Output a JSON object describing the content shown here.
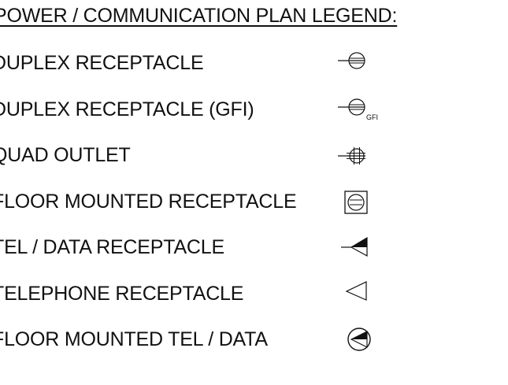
{
  "legend": {
    "title": "POWER / COMMUNICATION PLAN LEGEND:",
    "items": [
      {
        "label": "DUPLEX RECEPTACLE",
        "symbol": "duplex-receptacle-icon",
        "symbol_text": ""
      },
      {
        "label": "DUPLEX RECEPTACLE (GFI)",
        "symbol": "gfi-receptacle-icon",
        "symbol_text": "GFI"
      },
      {
        "label": "QUAD OUTLET",
        "symbol": "quad-outlet-icon",
        "symbol_text": ""
      },
      {
        "label": "FLOOR MOUNTED RECEPTACLE",
        "symbol": "floor-receptacle-icon",
        "symbol_text": ""
      },
      {
        "label": "TEL / DATA RECEPTACLE",
        "symbol": "tel-data-icon",
        "symbol_text": ""
      },
      {
        "label": "TELEPHONE RECEPTACLE",
        "symbol": "telephone-icon",
        "symbol_text": ""
      },
      {
        "label": "FLOOR MOUNTED TEL / DATA",
        "symbol": "floor-tel-data-icon",
        "symbol_text": ""
      }
    ]
  },
  "colors": {
    "line": "#111111",
    "background": "#ffffff"
  }
}
